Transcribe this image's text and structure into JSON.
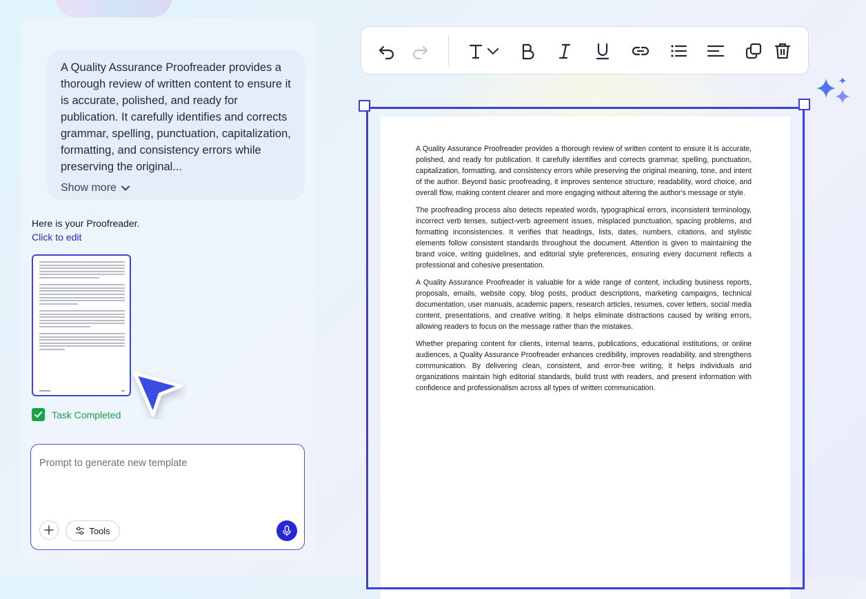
{
  "chat": {
    "description": "A Quality Assurance Proofreader provides a thorough review of written content to ensure it is accurate, polished, and ready for publication. It carefully identifies and corrects grammar, spelling, punctuation, capitalization, formatting, and consistency errors while preserving the original...",
    "show_more": "Show more",
    "intro": "Here is your Proofreader.",
    "edit_link": "Click to edit",
    "task_status": "Task Completed"
  },
  "prompt": {
    "placeholder": "Prompt to generate new template",
    "tools_label": "Tools"
  },
  "toolbar": {
    "tools": [
      "undo-icon",
      "redo-icon",
      "text-style-icon",
      "bold-icon",
      "italic-icon",
      "underline-icon",
      "link-icon",
      "bullet-list-icon",
      "align-icon",
      "duplicate-icon",
      "delete-icon"
    ]
  },
  "document": {
    "paragraphs": [
      "A Quality Assurance Proofreader provides a thorough review of written content to ensure it is accurate, polished, and ready for publication. It carefully identifies and corrects grammar, spelling, punctuation, capitalization, formatting, and consistency errors while preserving the original meaning, tone, and intent of the author. Beyond basic proofreading, it improves sentence structure, readability, word choice, and overall flow, making content clearer and more engaging without altering the author's message or style.",
      "The proofreading process also detects repeated words, typographical errors, inconsistent terminology, incorrect verb tenses, subject-verb agreement issues, misplaced punctuation, spacing problems, and formatting inconsistencies. It verifies that headings, lists, dates, numbers, citations, and stylistic elements follow consistent standards throughout the document. Attention is given to maintaining the brand voice, writing guidelines, and editorial style preferences, ensuring every document reflects a professional and cohesive presentation.",
      "A Quality Assurance Proofreader is valuable for a wide range of content, including business reports, proposals, emails, website copy, blog posts, product descriptions, marketing campaigns, technical documentation, user manuals, academic papers, research articles, resumes, cover letters, social media content, presentations, and creative writing. It helps eliminate distractions caused by writing errors, allowing readers to focus on the message rather than the mistakes.",
      "Whether preparing content for clients, internal teams, publications, educational institutions, or online audiences, a Quality Assurance Proofreader enhances credibility, improves readability, and strengthens communication. By delivering clean, consistent, and error-free writing, it helps individuals and organizations maintain high editorial standards, build trust with readers, and present information with confidence and professionalism across all types of written communication."
    ]
  },
  "colors": {
    "accent": "#3c40d9",
    "success": "#16a34a",
    "link": "#2727c9"
  }
}
